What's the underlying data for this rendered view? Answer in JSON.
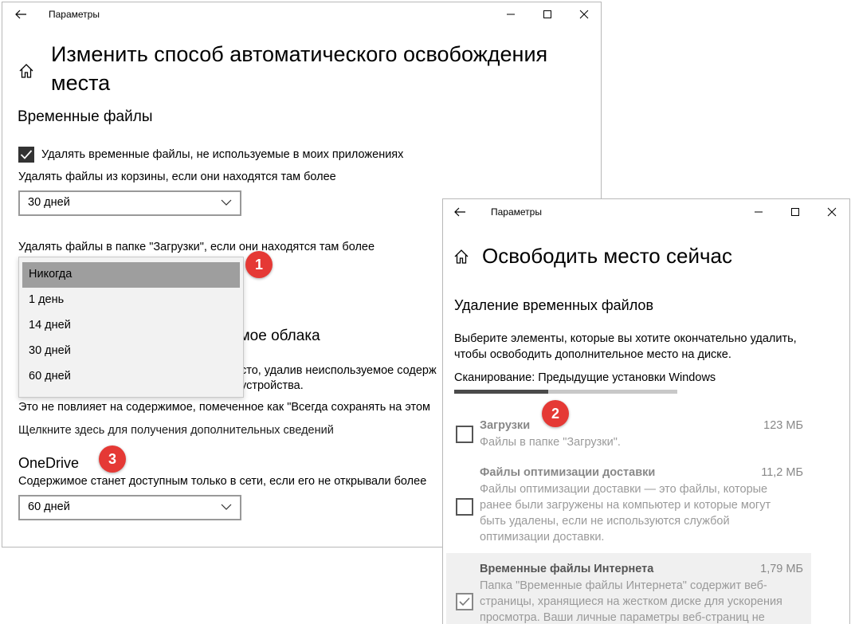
{
  "window1": {
    "title": "Параметры",
    "heading_line1": "Изменить способ автоматического освобождения",
    "heading_line2": "места",
    "temp_section_title": "Временные файлы",
    "delete_temp_checkbox_label": "Удалять временные файлы, не используемые в моих приложениях",
    "delete_temp_checked": true,
    "recycle_label": "Удалять файлы из корзины, если они находятся там более",
    "recycle_value": "30 дней",
    "downloads_label": "Удалять файлы в папке \"Загрузки\", если они находятся там более",
    "downloads_options": [
      "Никогда",
      "1 день",
      "14 дней",
      "30 дней",
      "60 дней"
    ],
    "downloads_selected": "Никогда",
    "cloud_section_partial": "имое облака",
    "cloud_desc_line1_partial": "сто, удалив неиспользуемое содерж",
    "cloud_desc_line2_partial": "устройства.",
    "cloud_note": "Это не повлияет на содержимое, помеченное как \"Всегда сохранять на этом",
    "more_info_link": "Щелкните здесь для получения дополнительных сведений",
    "onedrive_title": "OneDrive",
    "onedrive_desc": "Содержимое станет доступным только в сети, если его не открывали более",
    "onedrive_value": "60 дней"
  },
  "window2": {
    "title": "Параметры",
    "heading": "Освободить место сейчас",
    "section_title": "Удаление временных файлов",
    "desc_line1": "Выберите элементы, которые вы хотите окончательно удалить,",
    "desc_line2": "чтобы освободить дополнительное место на диске.",
    "scan_status": "Сканирование: Предыдущие установки Windows",
    "scan_progress": 0.42,
    "items": [
      {
        "title": "Загрузки",
        "size": "123 МБ",
        "checked": false,
        "desc": [
          "Файлы в папке \"Загрузки\"."
        ]
      },
      {
        "title": "Файлы оптимизации доставки",
        "size": "11,2 МБ",
        "checked": false,
        "desc": [
          "Файлы оптимизации доставки — это файлы, которые",
          "ранее были загружены на компьютер и которые могут",
          "быть удалены, если не используются службой",
          "оптимизации доставки."
        ]
      },
      {
        "title": "Временные файлы Интернета",
        "size": "1,79 МБ",
        "checked": true,
        "desc": [
          "Папка \"Временные файлы Интернета\" содержит веб-",
          "страницы, хранящиеся на жестком диске для ускорения",
          "просмотра. Ваши личные параметры веб-страниц не"
        ]
      }
    ]
  },
  "badges": [
    "1",
    "2",
    "3"
  ],
  "colors": {
    "badge": "#e53935",
    "selected_option": "#9e9e9e",
    "progress_fill": "#4a4a4a",
    "progress_track": "#c8c8c8"
  }
}
